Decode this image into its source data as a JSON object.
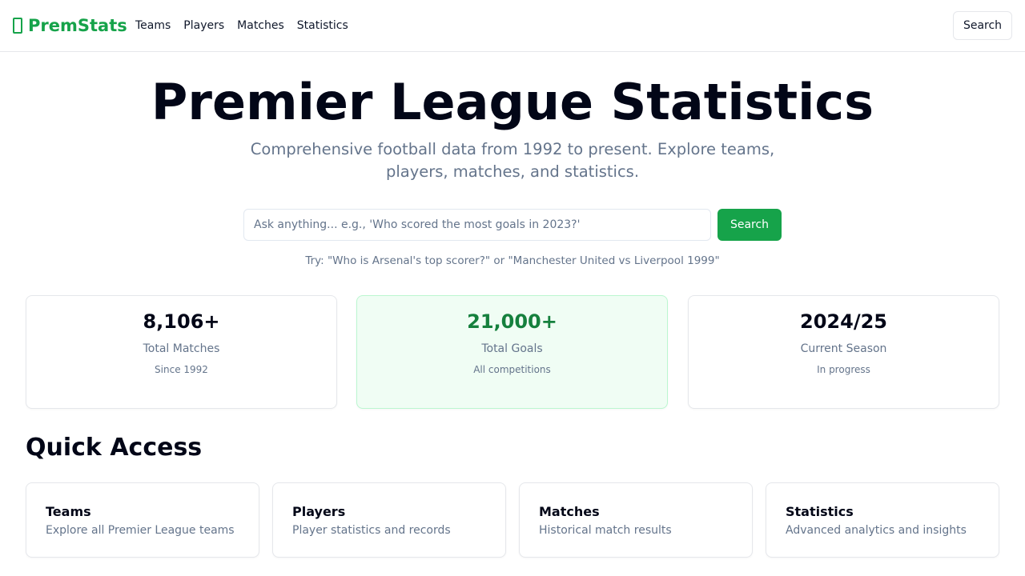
{
  "nav": {
    "brand": "PremStats",
    "links": [
      "Teams",
      "Players",
      "Matches",
      "Statistics"
    ],
    "search_label": "Search"
  },
  "hero": {
    "title": "Premier League Statistics",
    "subtitle": "Comprehensive football data from 1992 to present. Explore teams, players, matches, and statistics."
  },
  "search": {
    "placeholder": "Ask anything... e.g., 'Who scored the most goals in 2023?'",
    "value": "",
    "button_label": "Search",
    "hint": "Try: \"Who is Arsenal's top scorer?\" or \"Manchester United vs Liverpool 1999\""
  },
  "stats": [
    {
      "value": "8,106+",
      "label": "Total Matches",
      "note": "Since 1992"
    },
    {
      "value": "21,000+",
      "label": "Total Goals",
      "note": "All competitions"
    },
    {
      "value": "2024/25",
      "label": "Current Season",
      "note": "In progress"
    }
  ],
  "quick_access": {
    "title": "Quick Access",
    "cards": [
      {
        "title": "Teams",
        "desc": "Explore all Premier League teams"
      },
      {
        "title": "Players",
        "desc": "Player statistics and records"
      },
      {
        "title": "Matches",
        "desc": "Historical match results"
      },
      {
        "title": "Statistics",
        "desc": "Advanced analytics and insights"
      }
    ]
  },
  "colors": {
    "accent": "#16a34a",
    "accent_dark": "#15803d",
    "highlight_bg": "#f0fdf4"
  }
}
